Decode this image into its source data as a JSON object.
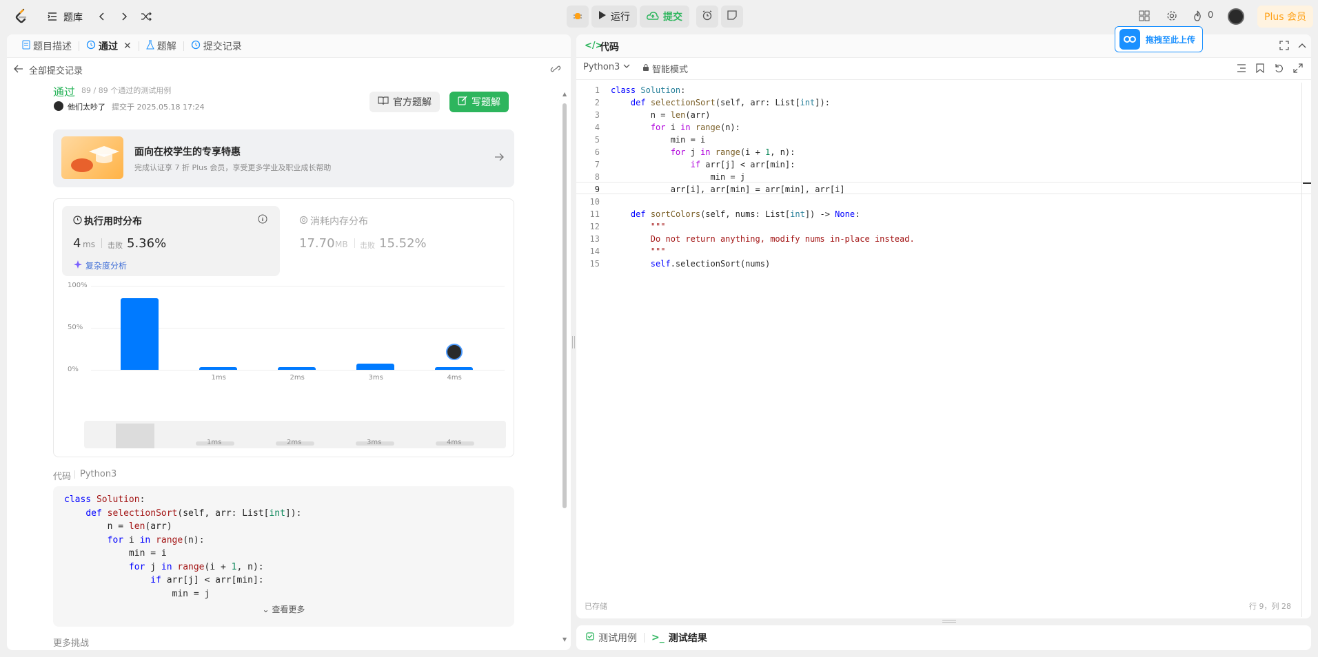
{
  "topbar": {
    "library_label": "题库",
    "run_label": "运行",
    "submit_label": "提交",
    "fire_count": "0",
    "plus_label": "Plus 会员",
    "upload_label": "拖拽至此上传"
  },
  "left": {
    "tabs": [
      {
        "label": "题目描述"
      },
      {
        "label": "通过"
      },
      {
        "label": "题解"
      },
      {
        "label": "提交记录"
      }
    ],
    "back_label": "全部提交记录",
    "status": "通过",
    "cases": "89 / 89 个通过的测试用例",
    "user": "他们太吵了",
    "submitted_at": "提交于 2025.05.18 17:24",
    "official_btn": "官方题解",
    "write_btn": "写题解",
    "promo_title": "面向在校学生的专享特惠",
    "promo_sub": "完成认证享 7 折 Plus 会员，享受更多学业及职业成长帮助",
    "runtime_title": "执行用时分布",
    "runtime_value": "4",
    "runtime_unit": "ms",
    "beats_label": "击败",
    "runtime_beats": "5.36%",
    "complexity_label": "复杂度分析",
    "memory_title": "消耗内存分布",
    "memory_value": "17.70",
    "memory_unit": "MB",
    "memory_beats": "15.52%",
    "code_label": "代码",
    "code_lang": "Python3",
    "see_more": "查看更多",
    "more_challenges": "更多挑战"
  },
  "chart_data": {
    "type": "bar",
    "categories": [
      "",
      "1ms",
      "2ms",
      "3ms",
      "4ms"
    ],
    "values": [
      85,
      3,
      3,
      7,
      3
    ],
    "ylim": [
      0,
      100
    ],
    "yticks": [
      "100%",
      "50%",
      "0%"
    ],
    "highlight_category": "4ms",
    "bar_color": "#007aff"
  },
  "right": {
    "title": "代码",
    "language": "Python3",
    "mode": "智能模式",
    "saved": "已存储",
    "cursor": "行 9，列 28",
    "testcase_tab": "测试用例",
    "result_tab": "测试结果"
  },
  "colors": {
    "accent_green": "#2db55d",
    "accent_blue": "#007aff",
    "plus_orange": "#ffa116"
  }
}
